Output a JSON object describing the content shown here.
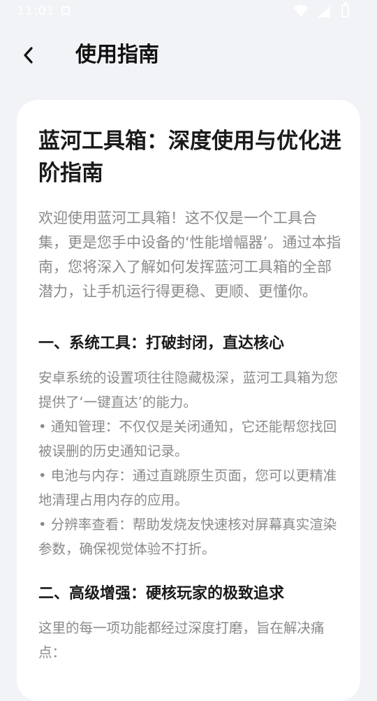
{
  "status_bar": {
    "time": "11:01"
  },
  "header": {
    "back_icon": "chevron-left-icon",
    "title": "使用指南"
  },
  "article": {
    "title": "蓝河工具箱：深度使用与优化进阶指南",
    "intro": "欢迎使用蓝河工具箱！这不仅是一个工具合集，更是您手中设备的‘性能增幅器’。通过本指南，您将深入了解如何发挥蓝河工具箱的全部潜力，让手机运行得更稳、更顺、更懂你。",
    "sections": [
      {
        "heading": "一、系统工具：打破封闭，直达核心",
        "body": "安卓系统的设置项往往隐藏极深，蓝河工具箱为您提供了‘一键直达’的能力。",
        "bullets": [
          "• 通知管理：不仅仅是关闭通知，它还能帮您找回被误删的历史通知记录。",
          "• 电池与内存：通过直跳原生页面，您可以更精准地清理占用内存的应用。",
          "• 分辨率查看：帮助发烧友快速核对屏幕真实渲染参数，确保视觉体验不打折。"
        ]
      },
      {
        "heading": "二、高级增强：硬核玩家的极致追求",
        "body": "这里的每一项功能都经过深度打磨，旨在解决痛点："
      }
    ]
  },
  "colors": {
    "background": "#f2f3f7",
    "card": "#ffffff",
    "title_text": "#1a1a1a",
    "body_text": "#8a8a8a"
  }
}
